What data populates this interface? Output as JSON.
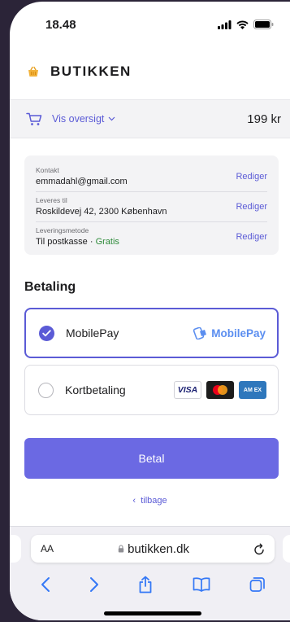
{
  "status_bar": {
    "time": "18.48"
  },
  "header": {
    "store_name": "BUTIKKEN"
  },
  "summary": {
    "toggle_label": "Vis oversigt",
    "total": "199 kr"
  },
  "info": {
    "contact_label": "Kontakt",
    "contact_value": "emmadahl@gmail.com",
    "ship_label": "Leveres til",
    "ship_value": "Roskildevej 42, 2300 København",
    "method_label": "Leveringsmetode",
    "method_value": "Til postkasse",
    "method_separator": " · ",
    "method_price": "Gratis",
    "edit_label": "Rediger"
  },
  "payment": {
    "title": "Betaling",
    "options": [
      {
        "label": "MobilePay",
        "brand": "MobilePay",
        "selected": true
      },
      {
        "label": "Kortbetaling",
        "selected": false
      }
    ],
    "card_brands": {
      "visa": "VISA",
      "amex": "AM EX"
    }
  },
  "actions": {
    "pay_label": "Betal",
    "back_label": "tilbage",
    "back_prefix": "‹"
  },
  "browser": {
    "text_size_label": "AA",
    "url": "butikken.dk"
  },
  "colors": {
    "accent": "#5b5bd6",
    "button": "#6b69e3",
    "mobilepay": "#5b8ef0",
    "free": "#2e8b3a"
  },
  "icons": [
    "basket-icon",
    "cart-icon",
    "chevron-down-icon",
    "check-icon",
    "lock-icon",
    "reload-icon",
    "back-icon",
    "forward-icon",
    "share-icon",
    "bookmarks-icon",
    "tabs-icon"
  ]
}
